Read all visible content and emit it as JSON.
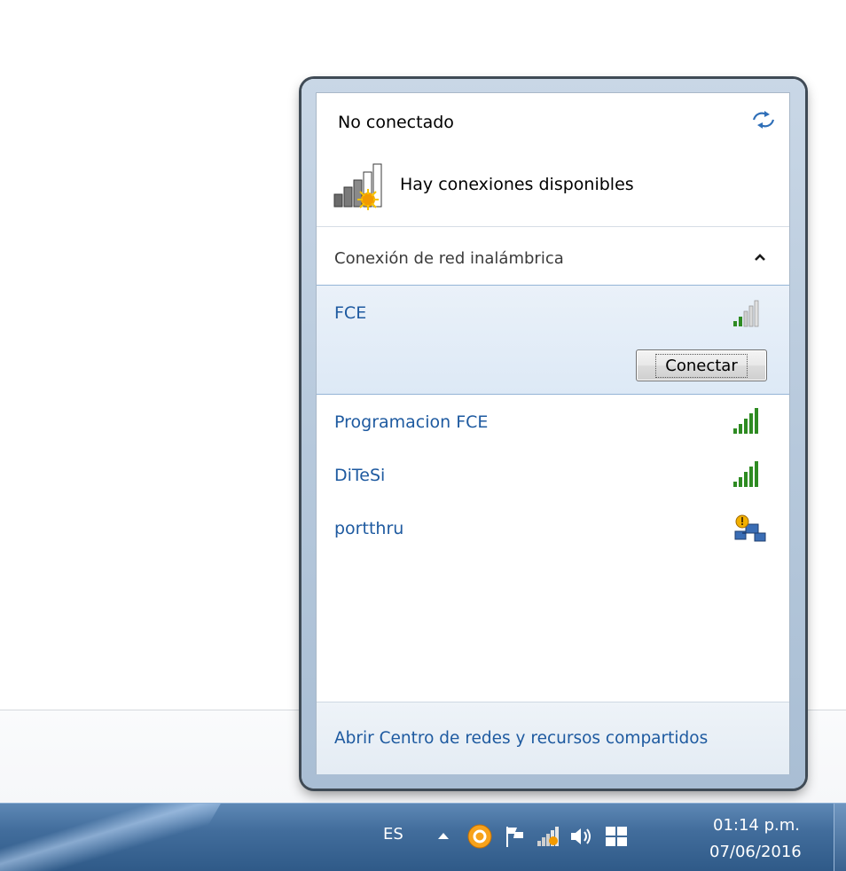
{
  "flyout": {
    "status_title": "No conectado",
    "availability_text": "Hay conexiones disponibles",
    "section_label": "Conexión de red inalámbrica",
    "selected_network": {
      "name": "FCE",
      "signal_bars": 2,
      "connect_label": "Conectar"
    },
    "networks": [
      {
        "name": "Programacion FCE",
        "signal_bars": 5,
        "icon": "signal-icon"
      },
      {
        "name": "DiTeSi",
        "signal_bars": 5,
        "icon": "signal-icon"
      },
      {
        "name": "portthru",
        "icon": "unsecured-network-icon"
      }
    ],
    "footer_link": "Abrir Centro de redes y recursos compartidos"
  },
  "taskbar": {
    "language": "ES",
    "tray_icons": [
      "show-hidden-icons",
      "app-orange-icon",
      "action-center-flag-icon",
      "network-icon",
      "volume-icon",
      "windows-icon"
    ],
    "time": "01:14 p.m.",
    "date": "07/06/2016"
  },
  "colors": {
    "link": "#1e5aa0",
    "signal_green": "#2e8b22",
    "taskbar": "#426d9c",
    "selection": "#dde9f6"
  }
}
